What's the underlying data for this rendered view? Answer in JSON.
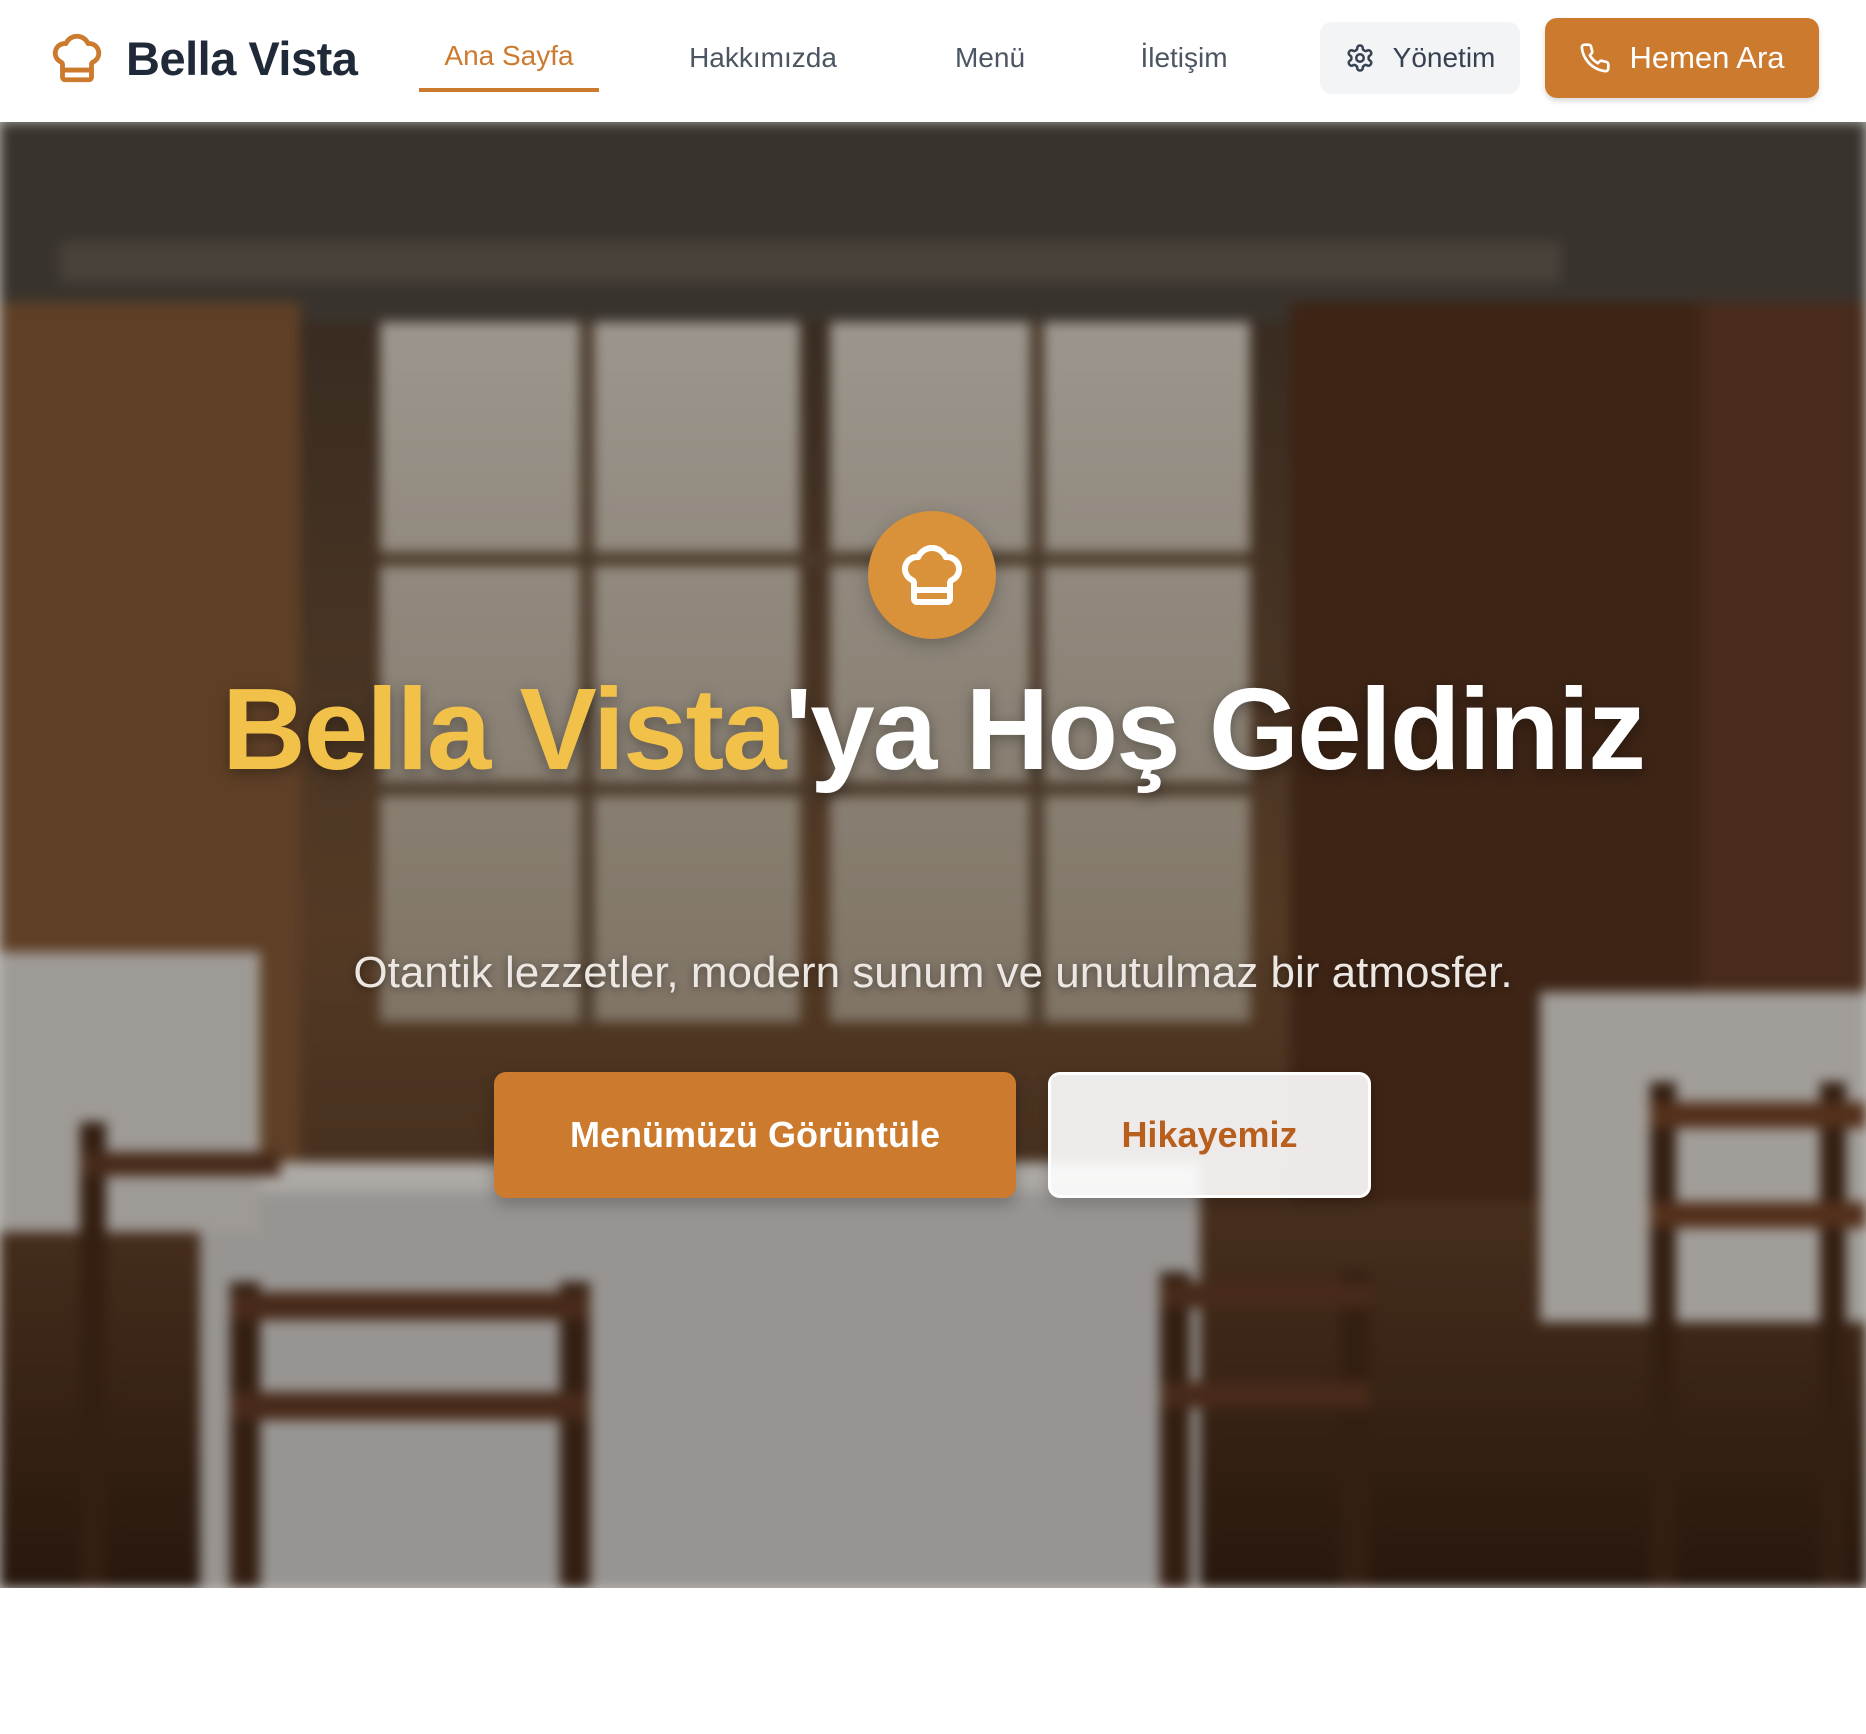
{
  "header": {
    "brand_name": "Bella Vista",
    "brand_icon": "chef-hat-icon",
    "nav": [
      {
        "label": "Ana Sayfa",
        "active": true
      },
      {
        "label": "Hakkımızda",
        "active": false
      },
      {
        "label": "Menü",
        "active": false
      },
      {
        "label": "İletişim",
        "active": false
      }
    ],
    "admin_label": "Yönetim",
    "admin_icon": "gear-icon",
    "call_label": "Hemen Ara",
    "call_icon": "phone-icon"
  },
  "hero": {
    "badge_icon": "chef-hat-icon",
    "title_accent": "Bella Vista",
    "title_rest": "'ya Hoş Geldiniz",
    "subtitle": "Otantik lezzetler, modern sunum ve unutulmaz bir atmosfer.",
    "primary_button": "Menümüzü Görüntüle",
    "secondary_button": "Hikayemiz",
    "background": "restaurant-interior-photo"
  },
  "colors": {
    "brand": "#cc7a2e",
    "accent_text": "#f2c14a",
    "secondary_button_text": "#b85f1e",
    "badge": "#d9923a"
  }
}
